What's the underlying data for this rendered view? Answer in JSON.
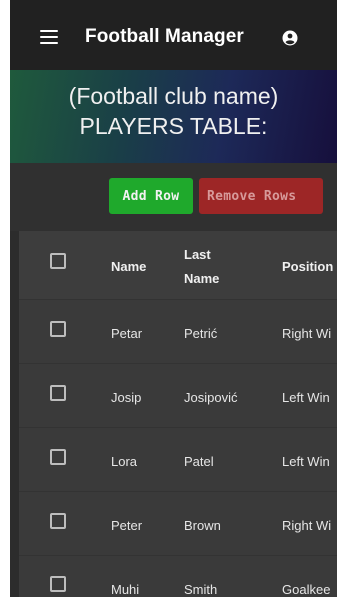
{
  "app": {
    "title": "Football Manager",
    "menu_icon": "hamburger-menu-icon",
    "account_icon": "account-circle-icon"
  },
  "hero": {
    "line1": "(Football club name)",
    "line2": "PLAYERS TABLE:"
  },
  "toolbar": {
    "add_label": "Add Row",
    "remove_label": "Remove Rows"
  },
  "table": {
    "headers": {
      "name": "Name",
      "last_name_1": "Last",
      "last_name_2": "Name",
      "position": "Position"
    },
    "rows": [
      {
        "name": "Petar",
        "last_name": "Petrić",
        "position": "Right Wi"
      },
      {
        "name": "Josip",
        "last_name": "Josipović",
        "position": "Left Win"
      },
      {
        "name": "Lora",
        "last_name": "Patel",
        "position": "Left Win"
      },
      {
        "name": "Peter",
        "last_name": "Brown",
        "position": "Right Wi"
      },
      {
        "name": "Muhi",
        "last_name": "Smith",
        "position": "Goalkee"
      }
    ]
  },
  "colors": {
    "add_button": "#1fa92c",
    "remove_button": "#9d2626",
    "app_bar": "#212121",
    "table_bg": "#3a3a3a"
  }
}
